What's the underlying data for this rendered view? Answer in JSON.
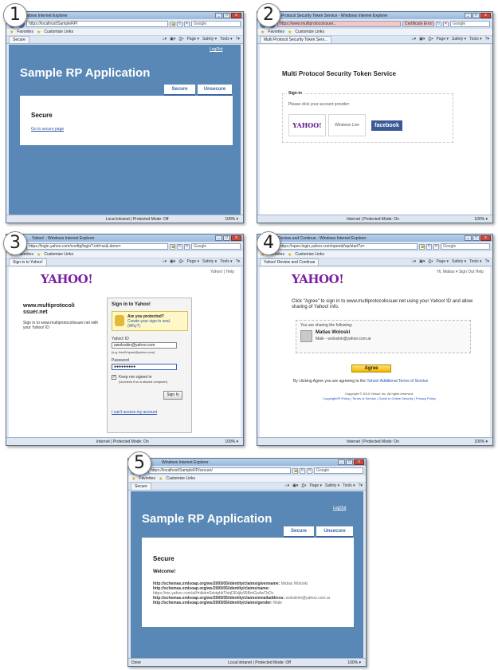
{
  "steps": [
    "1",
    "2",
    "3",
    "4",
    "5"
  ],
  "chrome": {
    "favorites": "Favorites",
    "customize_links": "Customize Links",
    "menu_page": "Page ▾",
    "menu_safety": "Safety ▾",
    "menu_tools": "Tools ▾",
    "zoom": "100% ▾",
    "search_placeholder": "Google"
  },
  "win1": {
    "title": "Windows Internet Explorer",
    "url": "https://localhost/SampleRP/",
    "tab": "Secure",
    "status_zone": "Local intranet | Protected Mode: Off",
    "logout": "LogOut",
    "app_title": "Sample RP Application",
    "tab_secure": "Secure",
    "tab_unsecure": "Unsecure",
    "heading": "Secure",
    "link": "Go to secure page"
  },
  "win2": {
    "title": "Multi Protocol Security Token Service - Windows Internet Explorer",
    "url": "https://www.multiprotocolssuer...",
    "cert_error": "Certificate Error",
    "tab": "Multi Protocol Security Token Serv...",
    "status_zone": "Internet | Protected Mode: On",
    "heading": "Multi Protocol Security Token Service",
    "legend": "Sign-in",
    "prompt": "Please click your account provider:",
    "providers": [
      "YAHOO!",
      "Windows Live",
      "facebook"
    ]
  },
  "win3": {
    "title": "Yahoo! - Windows Internet Explorer",
    "url": "https://login.yahoo.com/config/login?.intl=us&.done=",
    "tab": "Sign in to Yahoo!",
    "status_zone": "Internet | Protected Mode: On",
    "logo": "YAHOO!",
    "toplinks": "Yahoo! | Help",
    "site_name": "www.multiprotocoli ssuer.net",
    "site_text": "Sign in to www.multiprotocolissuer.net with your Yahoo! ID",
    "signin_title": "Sign in to Yahoo!",
    "protect_title": "Are you protected?",
    "protect_text": "Create your sign-in seal.",
    "protect_link": "(Why?)",
    "id_label": "Yahoo! ID",
    "id_value": "awoloskin@yahoo.com",
    "id_hint": "(e.g. free2rhyme@yahoo.com)",
    "pw_label": "Password",
    "pw_value": "●●●●●●●●●",
    "keep_signed": "Keep me signed in",
    "keep_hint": "(Uncheck if on a shared computer)",
    "signin_button": "Sign In",
    "forgot": "I can't access my account"
  },
  "win4": {
    "title": "Review and Continue - Windows Internet Explorer",
    "url": "https://open.login.yahoo.com/openid/op/start?z=",
    "tab": "Yahoo! Review and Continue",
    "status_zone": "Internet | Protected Mode: On",
    "logo": "YAHOO!",
    "toplinks": "Hi, Matias ▾  Sign Out  Help",
    "agree_text": "Click \"Agree\" to sign in to www.multiprotocolissuer.net using your Yahoo! ID and allow sharing of Yahoo! info.",
    "sharing_label": "You are sharing the following:",
    "user_name": "Matias Woloski",
    "user_detail": "Male - woloskin@yahoo.com.ar",
    "agree_button": "Agree",
    "fine_print_prefix": "By clicking Agree you are agreeing to the",
    "fine_print_link": "Yahoo! Additional Terms of Service",
    "copyright": "Copyright © 2010 Yahoo! Inc. All rights reserved.",
    "footer_links": "Copyright/IP Policy | Terms of Service | Guide to Online Security | Privacy Policy"
  },
  "win5": {
    "title": "Windows Internet Explorer",
    "url": "https://localhost/SampleRP/secure/",
    "tab": "Secure",
    "status_left": "Done",
    "status_zone": "Local intranet | Protected Mode: Off",
    "logout": "LogOut",
    "app_title": "Sample RP Application",
    "tab_secure": "Secure",
    "tab_unsecure": "Unsecure",
    "heading": "Secure",
    "welcome": "Welcome!",
    "claims": [
      {
        "type": "http://schemas.xmlsoap.org/ws/2005/05/identity/claims/givenname:",
        "value": "Matias Woloski"
      },
      {
        "type": "http://schemas.xmlsoap.org/ws/2005/05/identity/claims/name:",
        "value": "https://me.yahoo.com/a/HnlkdmSdvtphkThiqDEdjkr95BmGa4wTbOc"
      },
      {
        "type": "http://schemas.xmlsoap.org/ws/2005/05/identity/claims/emailaddress:",
        "value": "woloskim@yahoo.com.ar"
      },
      {
        "type": "http://schemas.xmlsoap.org/ws/2005/05/identity/claims/gender:",
        "value": "Male"
      }
    ]
  }
}
